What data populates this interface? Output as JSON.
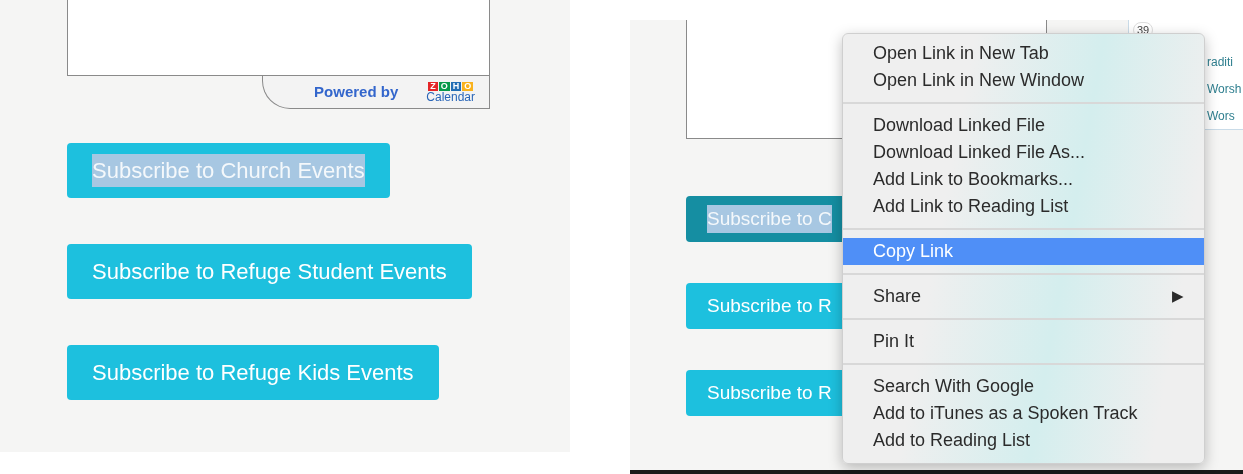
{
  "left_panel": {
    "calendar_footer": {
      "powered_by": "Powered by",
      "logo_letters": [
        {
          "letter": "Z",
          "color": "#e42527"
        },
        {
          "letter": "O",
          "color": "#089949"
        },
        {
          "letter": "H",
          "color": "#226db4"
        },
        {
          "letter": "O",
          "color": "#f9b21d"
        }
      ],
      "logo_caption": "Calendar"
    },
    "buttons": [
      {
        "label": "Subscribe to Church Events",
        "text_selected": true,
        "pressed": false
      },
      {
        "label": "Subscribe to Refuge Student Events",
        "text_selected": false,
        "pressed": false
      },
      {
        "label": "Subscribe to Refuge Kids Events",
        "text_selected": false,
        "pressed": false
      }
    ]
  },
  "right_panel": {
    "calendar_fragment": {
      "week_number": "39",
      "events": [
        "raditi",
        "Worsh",
        "Wors"
      ]
    },
    "buttons": [
      {
        "label": "Subscribe to C",
        "text_selected": true,
        "pressed": true
      },
      {
        "label": "Subscribe to R",
        "text_selected": false,
        "pressed": false
      },
      {
        "label": "Subscribe to R",
        "text_selected": false,
        "pressed": false
      }
    ],
    "context_menu": {
      "groups": [
        [
          {
            "label": "Open Link in New Tab",
            "selected": false
          },
          {
            "label": "Open Link in New Window",
            "selected": false
          }
        ],
        [
          {
            "label": "Download Linked File",
            "selected": false
          },
          {
            "label": "Download Linked File As...",
            "selected": false
          },
          {
            "label": "Add Link to Bookmarks...",
            "selected": false
          },
          {
            "label": "Add Link to Reading List",
            "selected": false
          }
        ],
        [
          {
            "label": "Copy Link",
            "selected": true
          }
        ],
        [
          {
            "label": "Share",
            "selected": false,
            "arrow": "▶"
          }
        ],
        [
          {
            "label": "Pin It",
            "selected": false
          }
        ],
        [
          {
            "label": "Search With Google",
            "selected": false
          },
          {
            "label": "Add to iTunes as a Spoken Track",
            "selected": false
          },
          {
            "label": "Add to Reading List",
            "selected": false
          }
        ]
      ]
    }
  }
}
